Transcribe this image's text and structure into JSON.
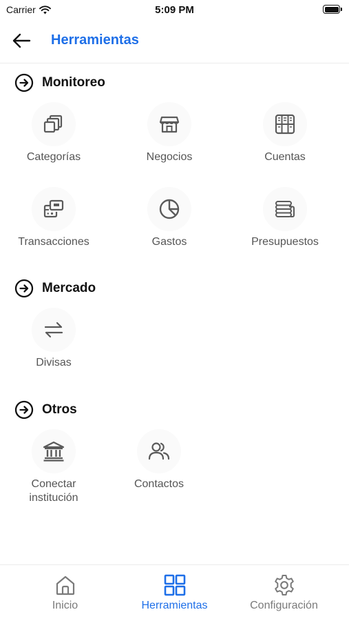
{
  "status_bar": {
    "carrier": "Carrier",
    "time": "5:09 PM"
  },
  "header": {
    "title": "Herramientas"
  },
  "sections": [
    {
      "title": "Monitoreo",
      "items": [
        {
          "label": "Categorías",
          "icon": "categories-icon"
        },
        {
          "label": "Negocios",
          "icon": "store-icon"
        },
        {
          "label": "Cuentas",
          "icon": "accounts-grid-icon"
        },
        {
          "label": "Transacciones",
          "icon": "transactions-icon"
        },
        {
          "label": "Gastos",
          "icon": "pie-chart-icon"
        },
        {
          "label": "Presupuestos",
          "icon": "coins-stack-icon"
        }
      ]
    },
    {
      "title": "Mercado",
      "items": [
        {
          "label": "Divisas",
          "icon": "exchange-arrows-icon"
        }
      ]
    },
    {
      "title": "Otros",
      "items": [
        {
          "label": "Conectar\ninstitución",
          "icon": "bank-icon"
        },
        {
          "label": "Contactos",
          "icon": "contacts-icon"
        }
      ]
    }
  ],
  "tabs": [
    {
      "label": "Inicio",
      "icon": "home-icon",
      "active": false
    },
    {
      "label": "Herramientas",
      "icon": "grid-icon",
      "active": true
    },
    {
      "label": "Configuración",
      "icon": "gear-icon",
      "active": false
    }
  ],
  "colors": {
    "accent": "#1e6fe8",
    "icon": "#5a5a5a",
    "text_muted": "#555555"
  }
}
